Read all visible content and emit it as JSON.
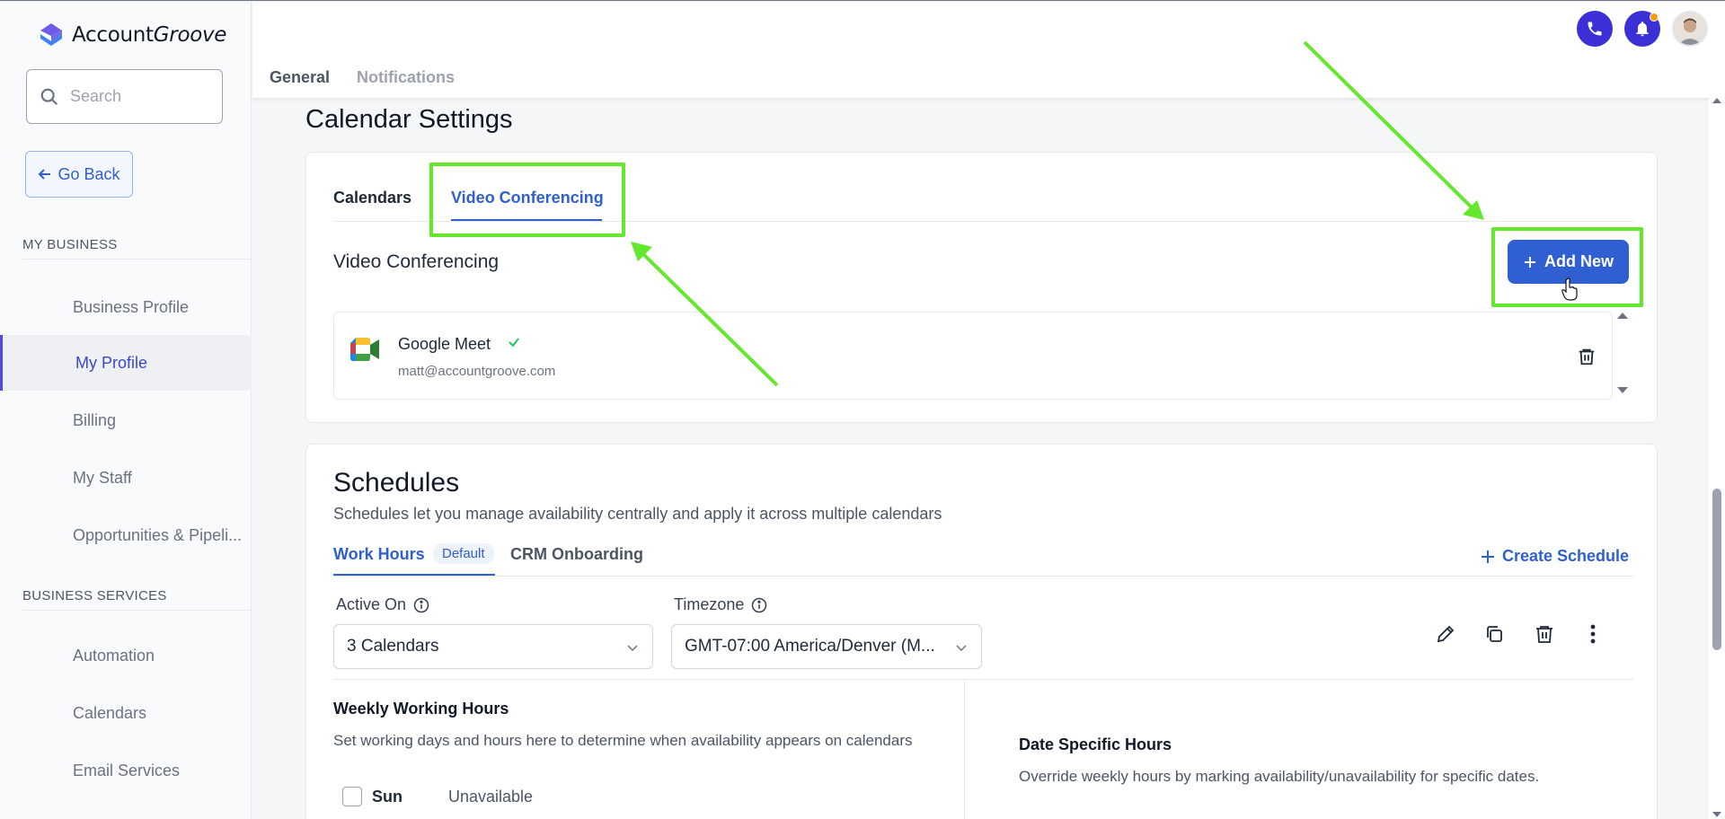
{
  "brand": {
    "name_prefix": "Account",
    "name_suffix": "Groove"
  },
  "sidebar": {
    "search_placeholder": "Search",
    "go_back": "Go Back",
    "section_business": "MY BUSINESS",
    "business_items": [
      {
        "label": "Business Profile"
      },
      {
        "label": "My Profile"
      },
      {
        "label": "Billing"
      },
      {
        "label": "My Staff"
      },
      {
        "label": "Opportunities & Pipeli..."
      }
    ],
    "section_services": "BUSINESS SERVICES",
    "service_items": [
      {
        "label": "Automation"
      },
      {
        "label": "Calendars"
      },
      {
        "label": "Email Services"
      }
    ]
  },
  "header": {
    "tabs": [
      {
        "label": "General"
      },
      {
        "label": "Notifications"
      }
    ]
  },
  "page": {
    "title": "Calendar Settings"
  },
  "calendar_card": {
    "tabs": [
      {
        "label": "Calendars"
      },
      {
        "label": "Video Conferencing"
      }
    ],
    "section_title": "Video Conferencing",
    "add_new": "Add New",
    "integration": {
      "name": "Google Meet",
      "email": "matt@accountgroove.com"
    }
  },
  "schedules": {
    "title": "Schedules",
    "subtitle": "Schedules let you manage availability centrally and apply it across multiple calendars",
    "tabs": [
      {
        "label": "Work Hours"
      },
      {
        "label": "CRM Onboarding"
      }
    ],
    "default_badge": "Default",
    "create_schedule": "Create Schedule",
    "active_on_label": "Active On",
    "active_on_value": "3 Calendars",
    "timezone_label": "Timezone",
    "timezone_value": "GMT-07:00 America/Denver (M...",
    "weekly_title": "Weekly Working Hours",
    "weekly_subtitle": "Set working days and hours here to determine when availability appears on calendars",
    "day": "Sun",
    "day_status": "Unavailable",
    "date_specific_title": "Date Specific Hours",
    "date_specific_subtitle": "Override weekly hours by marking availability/unavailability for specific dates."
  },
  "colors": {
    "accent": "#2f5fd0",
    "annotation": "#63e82d",
    "brand_purple": "#3b30d6"
  }
}
